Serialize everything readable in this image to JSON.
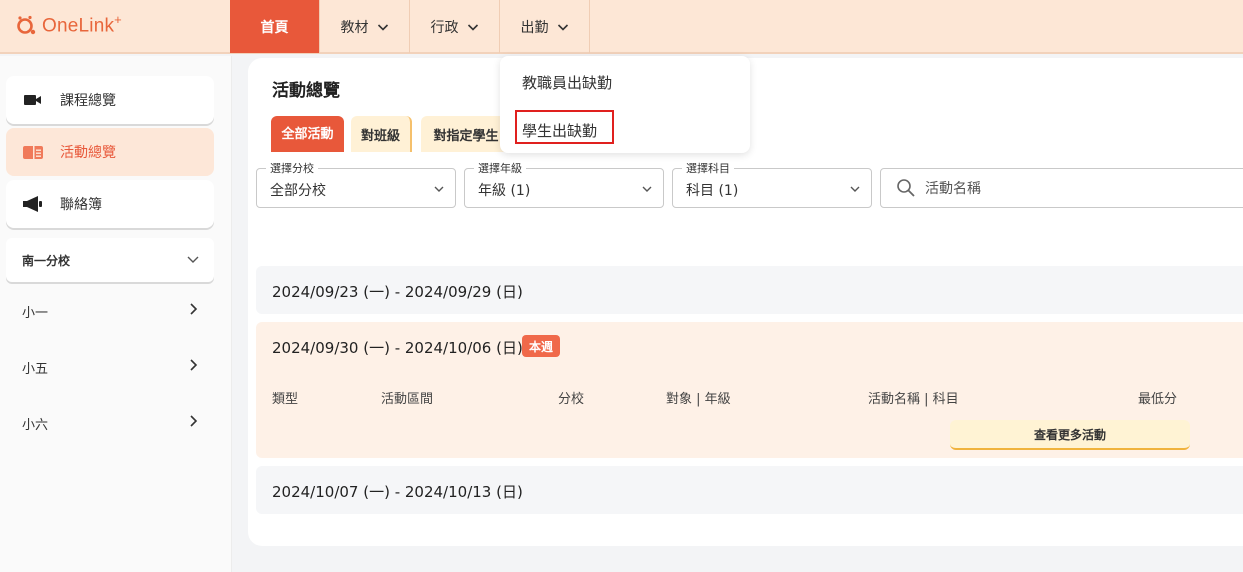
{
  "logo": {
    "text": "OneLink",
    "plus": "+"
  },
  "nav": {
    "items": [
      {
        "label": "首頁",
        "active": true,
        "has_dropdown": false
      },
      {
        "label": "教材",
        "active": false,
        "has_dropdown": true
      },
      {
        "label": "行政",
        "active": false,
        "has_dropdown": true
      },
      {
        "label": "出勤",
        "active": false,
        "has_dropdown": true
      }
    ]
  },
  "dropdown": {
    "items": [
      {
        "label": "教職員出缺勤"
      },
      {
        "label": "學生出缺勤",
        "highlighted": true
      }
    ]
  },
  "sidebar": {
    "items": [
      {
        "label": "課程總覽",
        "icon": "video-camera-icon",
        "active": false
      },
      {
        "label": "活動總覽",
        "icon": "book-icon",
        "active": true
      },
      {
        "label": "聯絡簿",
        "icon": "megaphone-icon",
        "active": false
      }
    ],
    "branch": {
      "label": "南一分校"
    },
    "grades": [
      {
        "label": "小一"
      },
      {
        "label": "小五"
      },
      {
        "label": "小六"
      }
    ]
  },
  "main": {
    "title": "活動總覽",
    "tabs": [
      {
        "label": "全部活動",
        "active": true
      },
      {
        "label": "對班級",
        "active": false
      },
      {
        "label": "對指定學生",
        "active": false
      }
    ],
    "filters": {
      "branch": {
        "label": "選擇分校",
        "value": "全部分校"
      },
      "grade": {
        "label": "選擇年級",
        "value": "年級 (1)"
      },
      "subject": {
        "label": "選擇科目",
        "value": "科目 (1)"
      },
      "search": {
        "placeholder": "活動名稱",
        "value": ""
      }
    },
    "weeks": [
      {
        "range": "2024/09/23 (一) - 2024/09/29 (日)",
        "current": false
      },
      {
        "range": "2024/09/30 (一) - 2024/10/06 (日)",
        "current": true,
        "badge": "本週",
        "columns": [
          "類型",
          "活動區間",
          "分校",
          "對象 | 年級",
          "活動名稱 | 科目",
          "最低分"
        ],
        "more_button": "查看更多活動"
      },
      {
        "range": "2024/10/07 (一) - 2024/10/13 (日)",
        "current": false
      }
    ]
  },
  "colors": {
    "accent": "#e8583a",
    "topbar_bg": "#fde7d6",
    "highlight_border": "#e0201e"
  }
}
